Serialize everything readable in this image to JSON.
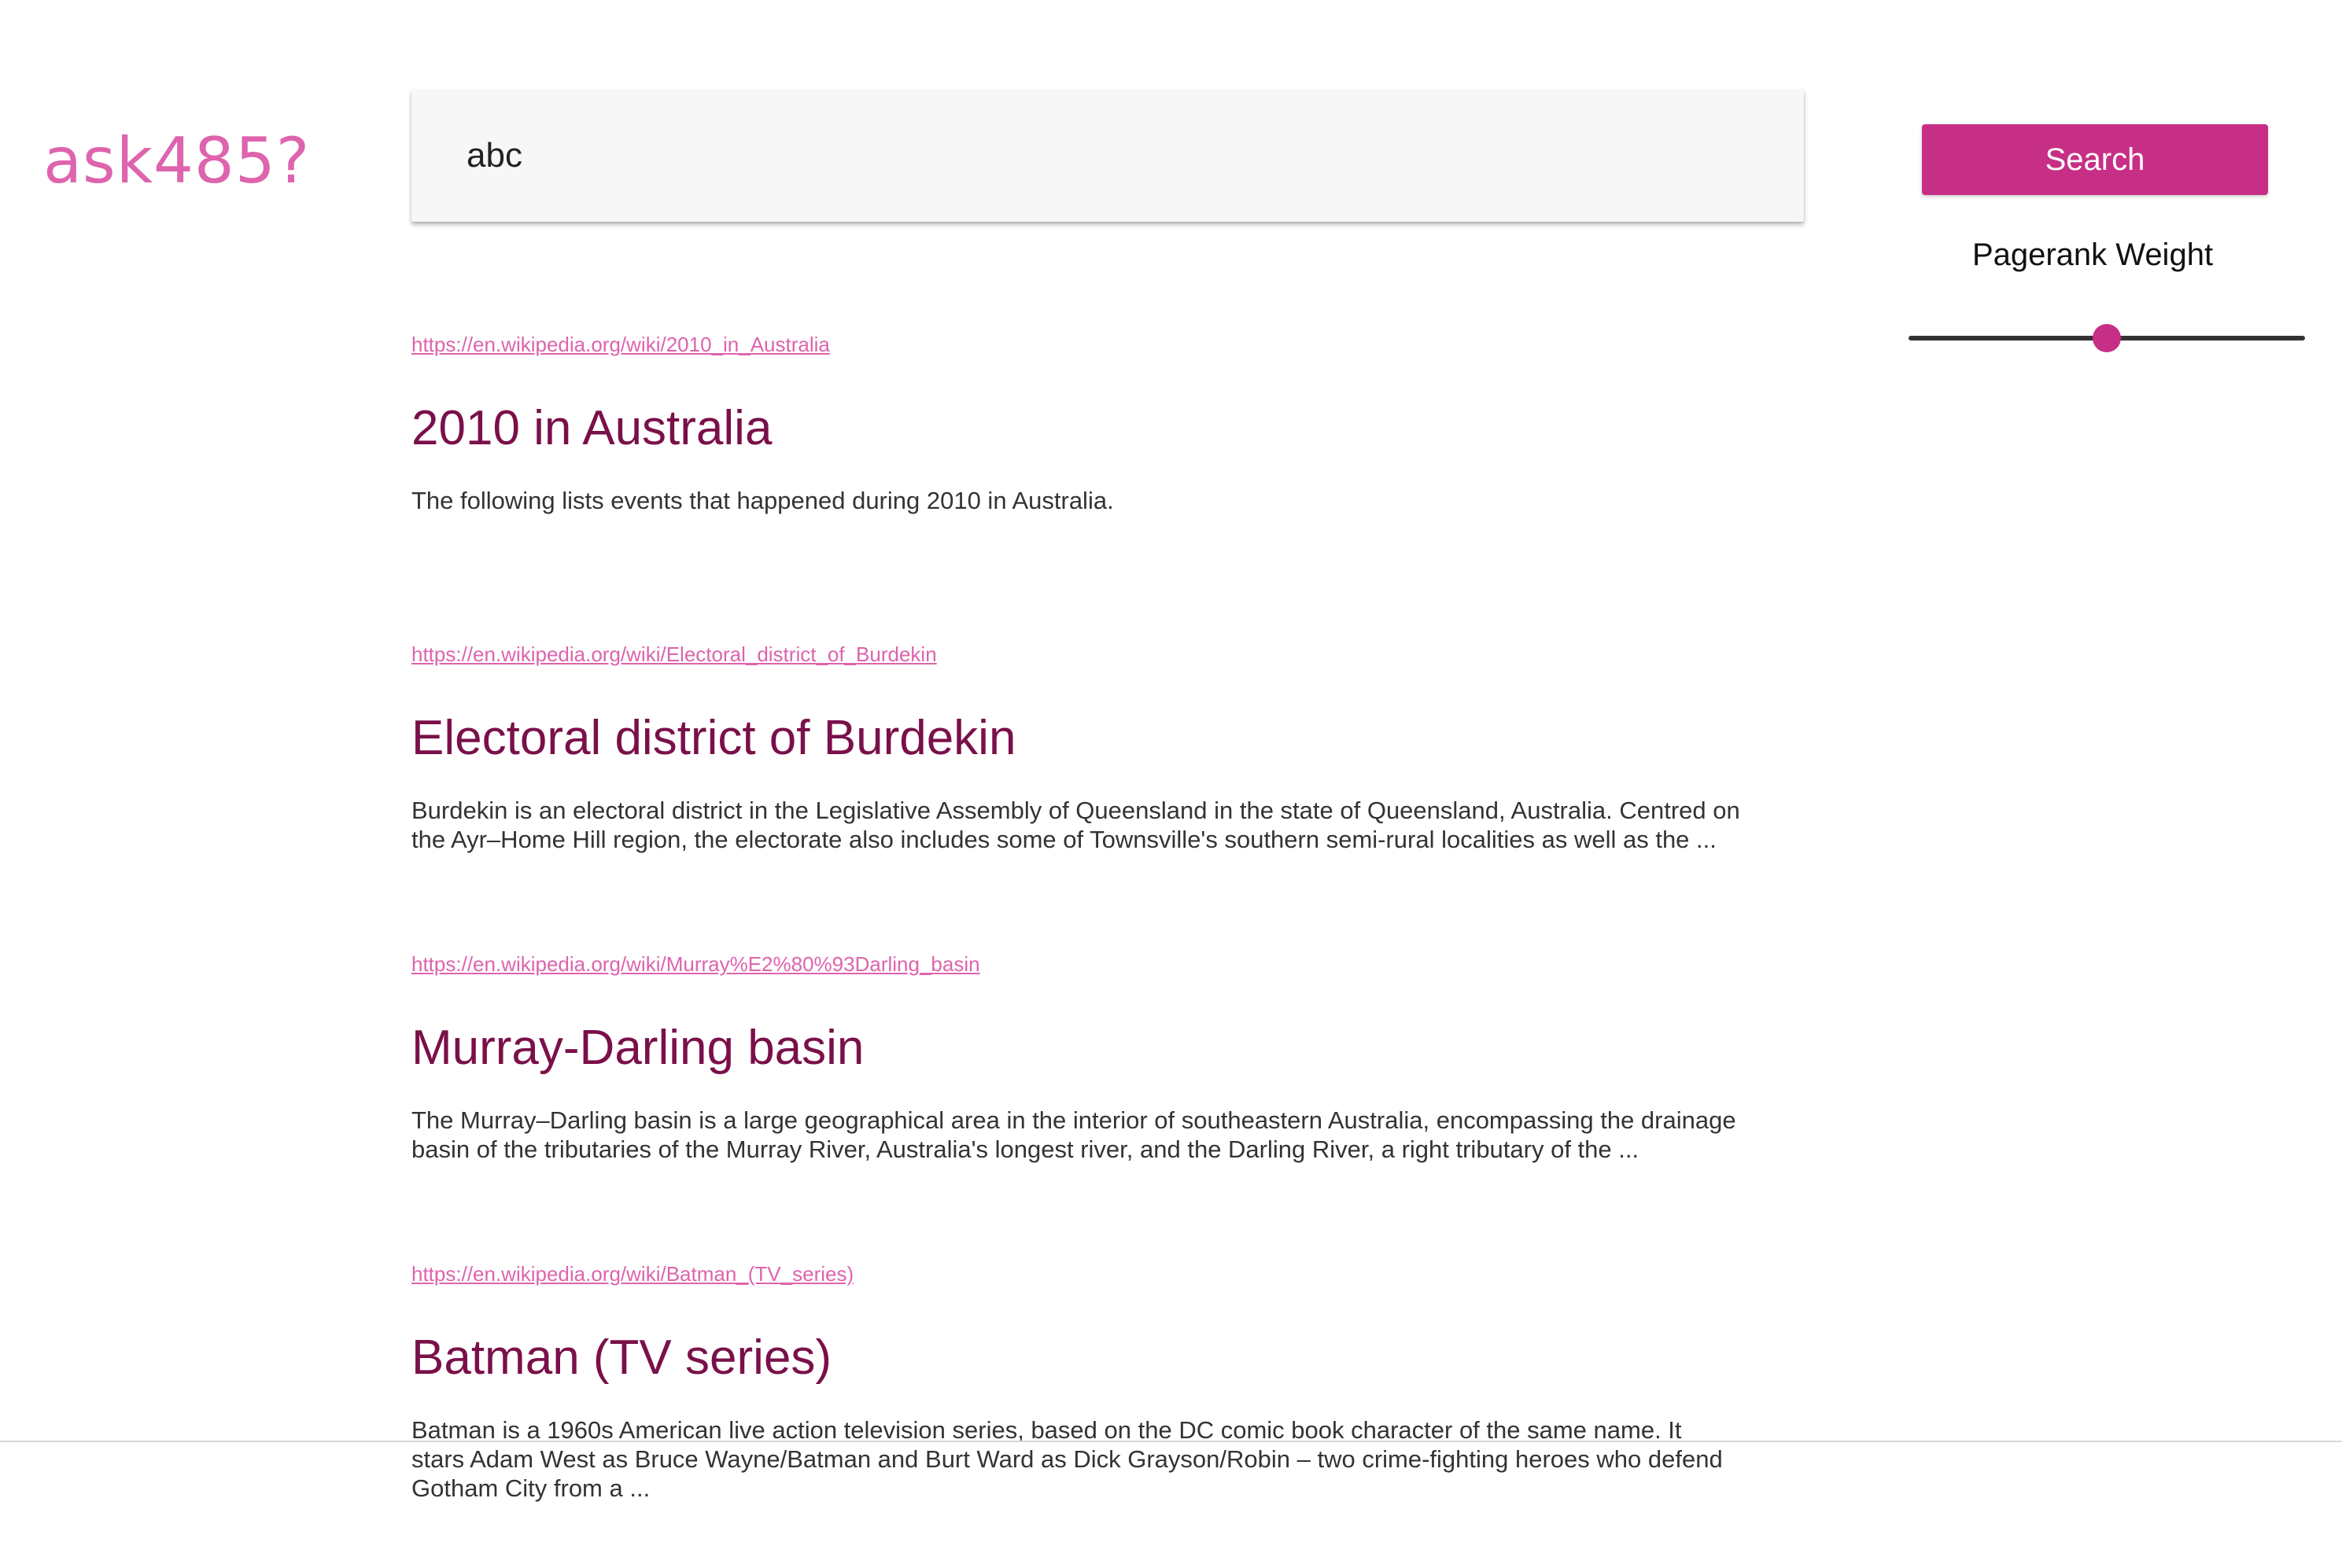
{
  "app": {
    "logo": "ask485?"
  },
  "search": {
    "value": "abc",
    "button_label": "Search"
  },
  "pagerank": {
    "label": "Pagerank Weight",
    "value": 0.5
  },
  "results": [
    {
      "url": "https://en.wikipedia.org/wiki/2010_in_Australia",
      "title": "2010 in Australia",
      "snippet": "The following lists events that happened during 2010 in Australia."
    },
    {
      "url": "https://en.wikipedia.org/wiki/Electoral_district_of_Burdekin",
      "title": "Electoral district of Burdekin",
      "snippet": "Burdekin is an electoral district in the Legislative Assembly of Queensland in the state of Queensland, Australia. Centred on the Ayr–Home Hill region, the electorate also includes some of Townsville's southern semi-rural localities as well as the ..."
    },
    {
      "url": "https://en.wikipedia.org/wiki/Murray%E2%80%93Darling_basin",
      "title": "Murray-Darling basin",
      "snippet": "The Murray–Darling basin is a large geographical area in the interior of southeastern Australia, encompassing the drainage basin of the tributaries of the Murray River, Australia's longest river, and the Darling River, a right tributary of the ..."
    },
    {
      "url": "https://en.wikipedia.org/wiki/Batman_(TV_series)",
      "title": "Batman (TV series)",
      "snippet": "Batman is a 1960s American live action television series, based on the DC comic book character of the same name. It stars Adam West as Bruce Wayne/Batman and Burt Ward as Dick Grayson/Robin – two crime-fighting heroes who defend Gotham City from a ..."
    }
  ],
  "colors": {
    "accent": "#c72f86",
    "logo": "#dd64ad",
    "title": "#7a1049"
  }
}
